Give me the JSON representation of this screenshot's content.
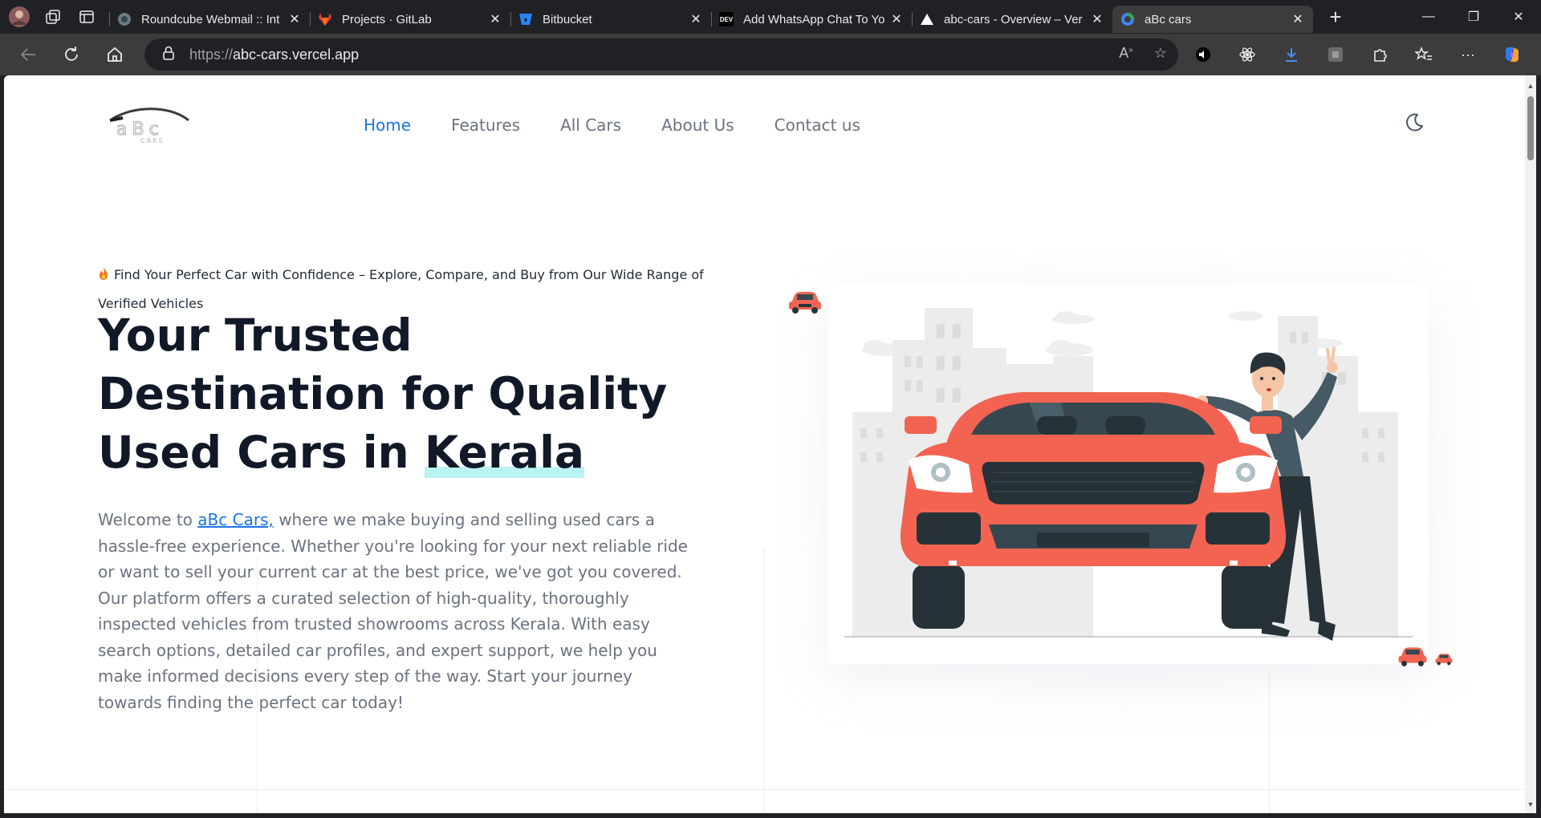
{
  "browser": {
    "tabs": [
      {
        "title": "Roundcube Webmail :: Int",
        "favicon": "roundcube-icon"
      },
      {
        "title": "Projects · GitLab",
        "favicon": "gitlab-icon"
      },
      {
        "title": "Bitbucket",
        "favicon": "bitbucket-icon"
      },
      {
        "title": "Add WhatsApp Chat To Yo",
        "favicon": "dev-icon",
        "favicon_text": "DEV"
      },
      {
        "title": "abc-cars - Overview – Ver",
        "favicon": "vercel-icon"
      },
      {
        "title": "aBc cars",
        "favicon": "abc-cars-icon",
        "active": true
      }
    ],
    "url_scheme": "https://",
    "url_host": "abc-cars.vercel.app"
  },
  "page": {
    "logo_text": "aBc",
    "logo_sub": "CARS",
    "nav": [
      {
        "label": "Home",
        "active": true
      },
      {
        "label": "Features"
      },
      {
        "label": "All Cars"
      },
      {
        "label": "About Us"
      },
      {
        "label": "Contact us"
      }
    ],
    "tagline": "Find Your Perfect Car with Confidence – Explore, Compare, and Buy from Our Wide Range of Verified Vehicles",
    "headline_part1": "Your Trusted Destination for Quality Used Cars in ",
    "headline_highlight": "Kerala",
    "para_prefix": "Welcome to ",
    "para_link": "aBc Cars,",
    "para_rest": " where we make buying and selling used cars a hassle-free experience. Whether you're looking for your next reliable ride or want to sell your current car at the best price, we've got you covered. Our platform offers a curated selection of high-quality, thoroughly inspected vehicles from trusted showrooms across Kerala. With easy search options, detailed car profiles, and expert support, we help you make informed decisions every step of the way. Start your journey towards finding the perfect car today!"
  },
  "colors": {
    "accent": "#1a73e8",
    "car_red": "#f26451",
    "dark": "#263238",
    "highlight": "#b9f3f3"
  }
}
